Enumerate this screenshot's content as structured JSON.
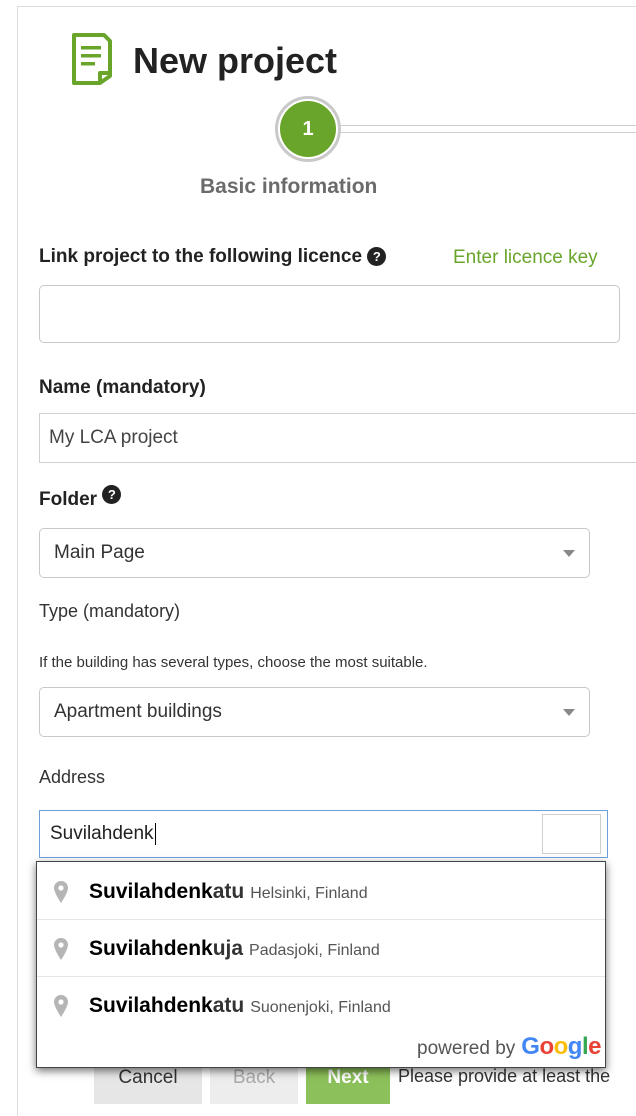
{
  "header": {
    "title": "New project",
    "icon": "document-icon",
    "accent_color": "#6aa52b"
  },
  "stepper": {
    "steps": [
      {
        "number": "1",
        "label": "Basic information"
      }
    ]
  },
  "form": {
    "licence": {
      "label": "Link project to the following licence",
      "help": "?",
      "link_text": "Enter licence key",
      "value": ""
    },
    "name": {
      "label": "Name (mandatory)",
      "value": "My LCA project"
    },
    "folder": {
      "label": "Folder",
      "help": "?",
      "selected": "Main Page"
    },
    "type": {
      "label": "Type (mandatory)",
      "hint": "If the building has several types, choose the most suitable.",
      "selected": "Apartment buildings"
    },
    "address": {
      "label": "Address",
      "value": "Suvilahdenk"
    }
  },
  "autocomplete": {
    "items": [
      {
        "match": "Suvilahdenk",
        "rest": "atu",
        "secondary": "Helsinki, Finland"
      },
      {
        "match": "Suvilahdenk",
        "rest": "uja",
        "secondary": "Padasjoki, Finland"
      },
      {
        "match": "Suvilahdenk",
        "rest": "atu",
        "secondary": "Suonenjoki, Finland"
      }
    ],
    "powered_by": "powered by",
    "google": [
      "G",
      "o",
      "o",
      "g",
      "l",
      "e"
    ]
  },
  "footer": {
    "cancel_label": "Cancel",
    "back_label": "Back",
    "next_label": "Next",
    "note": "Please provide at least the"
  }
}
